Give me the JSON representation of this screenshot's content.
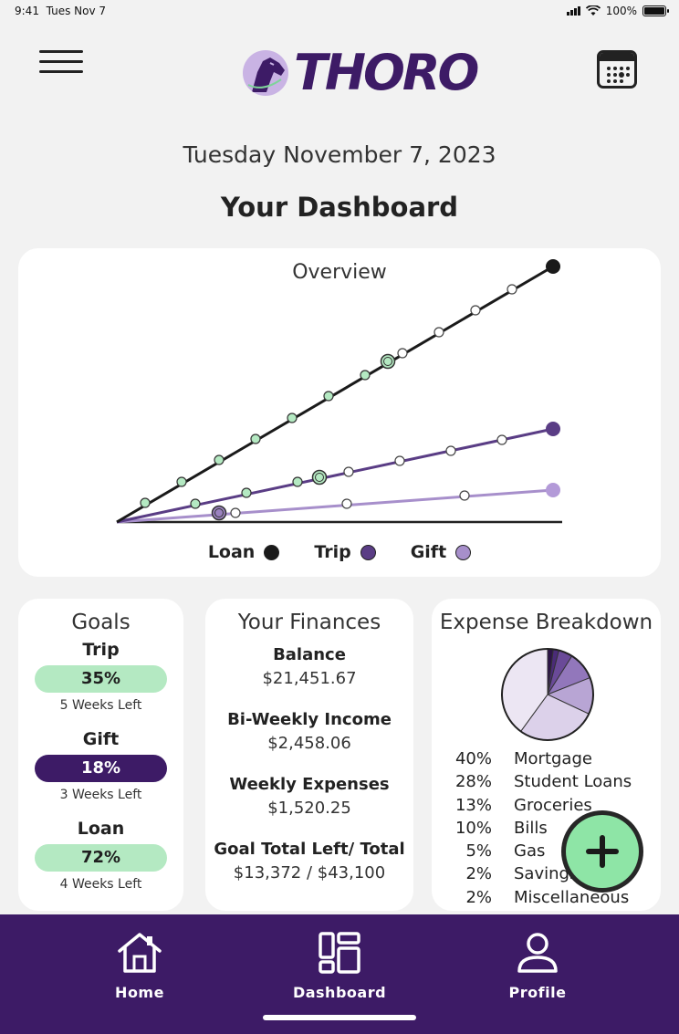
{
  "status": {
    "time": "9:41",
    "date": "Tues Nov 7",
    "battery": "100%"
  },
  "brand": {
    "name": "THORO",
    "color": "#3d1b66"
  },
  "header": {
    "date": "Tuesday November 7, 2023",
    "title": "Your Dashboard"
  },
  "overview": {
    "title": "Overview",
    "legend": [
      {
        "label": "Loan",
        "color": "#1a1a1a"
      },
      {
        "label": "Trip",
        "color": "#5a3d85"
      },
      {
        "label": "Gift",
        "color": "#a78fcb"
      }
    ]
  },
  "goals": {
    "title": "Goals",
    "items": [
      {
        "label": "Trip",
        "percent": "35%",
        "sub": "5 Weeks Left",
        "bg": "#b4e9c2",
        "fg": "#1f1f1f"
      },
      {
        "label": "Gift",
        "percent": "18%",
        "sub": "3 Weeks Left",
        "bg": "#3d1b66",
        "fg": "#ffffff"
      },
      {
        "label": "Loan",
        "percent": "72%",
        "sub": "4 Weeks Left",
        "bg": "#b4e9c2",
        "fg": "#1f1f1f"
      }
    ]
  },
  "finances": {
    "title": "Your Finances",
    "items": [
      {
        "label": "Balance",
        "value": "$21,451.67"
      },
      {
        "label": "Bi-Weekly Income",
        "value": "$2,458.06"
      },
      {
        "label": "Weekly Expenses",
        "value": "$1,520.25"
      },
      {
        "label": "Goal Total Left/ Total",
        "value": "$13,372 / $43,100"
      }
    ]
  },
  "expenses": {
    "title": "Expense Breakdown",
    "items": [
      {
        "pct": "40%",
        "name": "Mortgage",
        "value": 40,
        "color": "#ece6f3"
      },
      {
        "pct": "28%",
        "name": "Student Loans",
        "value": 28,
        "color": "#dcd1ea"
      },
      {
        "pct": "13%",
        "name": "Groceries",
        "value": 13,
        "color": "#b8a5d4"
      },
      {
        "pct": "10%",
        "name": "Bills",
        "value": 10,
        "color": "#9277bb"
      },
      {
        "pct": "5%",
        "name": "Gas",
        "value": 5,
        "color": "#6a4a98"
      },
      {
        "pct": "2%",
        "name": "Savings",
        "value": 2,
        "color": "#4a2b78"
      },
      {
        "pct": "2%",
        "name": "Miscellaneous",
        "value": 2,
        "color": "#2c1348"
      }
    ]
  },
  "tabs": [
    {
      "label": "Home",
      "icon": "home-icon"
    },
    {
      "label": "Dashboard",
      "icon": "dashboard-icon"
    },
    {
      "label": "Profile",
      "icon": "profile-icon"
    }
  ],
  "fab": {
    "icon": "plus-icon"
  }
}
